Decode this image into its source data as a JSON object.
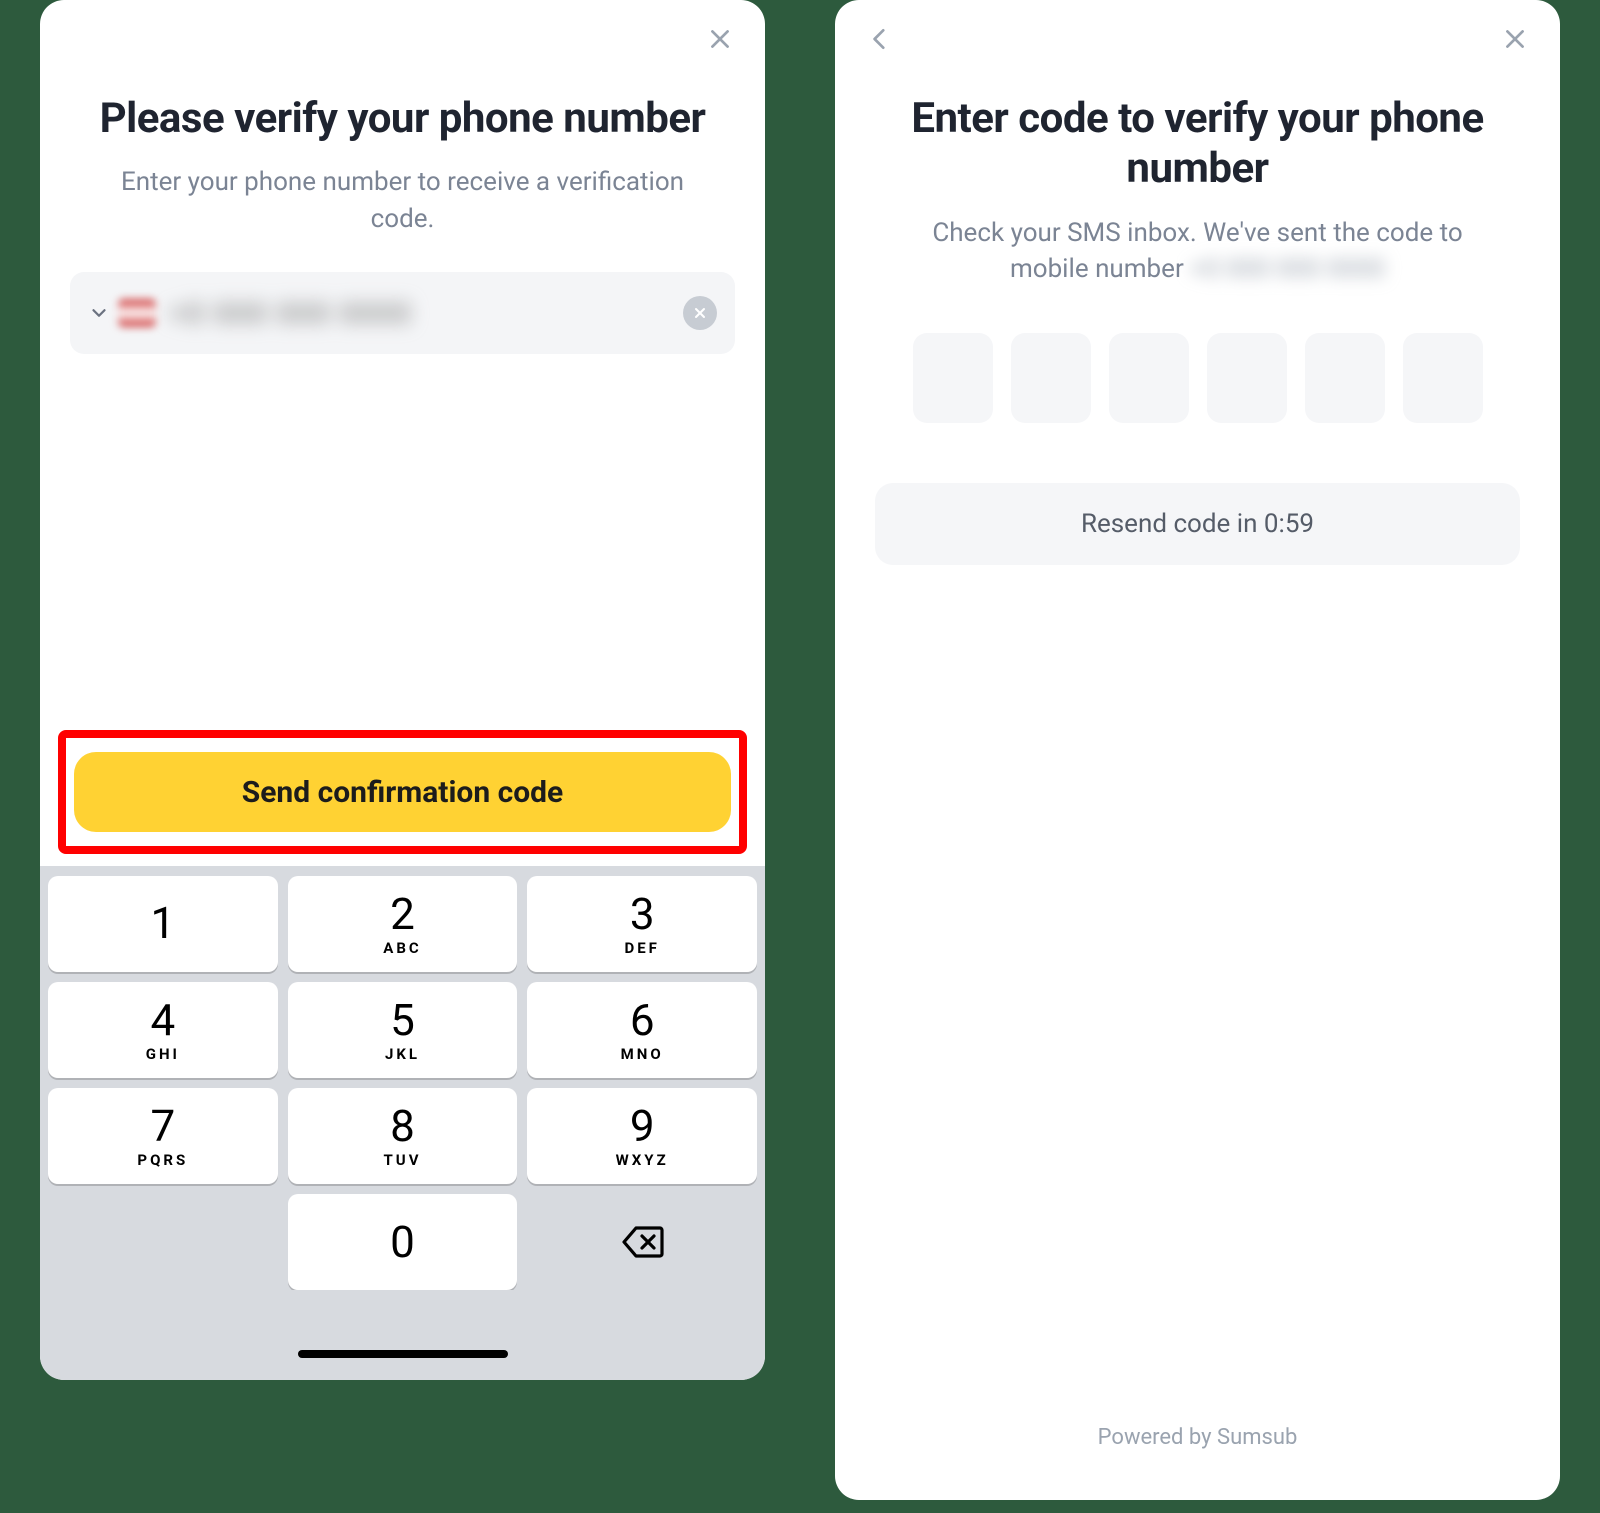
{
  "left": {
    "title": "Please verify your phone number",
    "subtitle": "Enter your phone number to receive a verification code.",
    "phone_value_masked": "+0 000 000 0000",
    "send_button": "Send confirmation code",
    "keypad": [
      {
        "digit": "1",
        "letters": ""
      },
      {
        "digit": "2",
        "letters": "ABC"
      },
      {
        "digit": "3",
        "letters": "DEF"
      },
      {
        "digit": "4",
        "letters": "GHI"
      },
      {
        "digit": "5",
        "letters": "JKL"
      },
      {
        "digit": "6",
        "letters": "MNO"
      },
      {
        "digit": "7",
        "letters": "PQRS"
      },
      {
        "digit": "8",
        "letters": "TUV"
      },
      {
        "digit": "9",
        "letters": "WXYZ"
      },
      {
        "digit": "0",
        "letters": ""
      }
    ]
  },
  "right": {
    "title": "Enter code to verify your phone number",
    "subtitle_prefix": "Check your SMS inbox. We've sent the code to mobile number ",
    "subtitle_masked": "+0 000 000 0000",
    "resend_label": "Resend code in 0:59",
    "powered": "Powered by Sumsub"
  }
}
